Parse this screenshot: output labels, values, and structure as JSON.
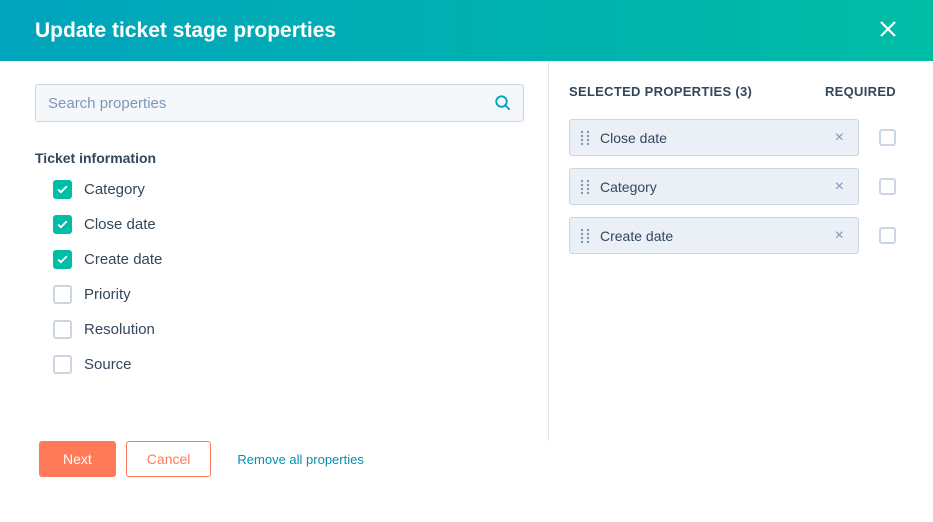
{
  "header": {
    "title": "Update ticket stage properties"
  },
  "search": {
    "placeholder": "Search properties"
  },
  "group": {
    "label": "Ticket information"
  },
  "properties": [
    {
      "label": "Category",
      "checked": true
    },
    {
      "label": "Close date",
      "checked": true
    },
    {
      "label": "Create date",
      "checked": true
    },
    {
      "label": "Priority",
      "checked": false
    },
    {
      "label": "Resolution",
      "checked": false
    },
    {
      "label": "Source",
      "checked": false
    }
  ],
  "rightHeaders": {
    "selected": "SELECTED PROPERTIES (3)",
    "required": "REQUIRED"
  },
  "selected": [
    {
      "label": "Close date"
    },
    {
      "label": "Category"
    },
    {
      "label": "Create date"
    }
  ],
  "footer": {
    "next": "Next",
    "cancel": "Cancel",
    "removeAll": "Remove all properties"
  }
}
